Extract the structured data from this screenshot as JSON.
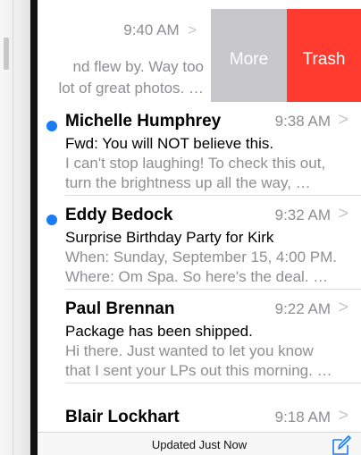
{
  "swiped_message": {
    "time": "9:40 AM",
    "chevron": ">",
    "preview_line_1": "nd flew by. Way too",
    "preview_line_2": "lot of great photos. …",
    "more_label": "More",
    "trash_label": "Trash"
  },
  "messages": [
    {
      "sender": "Michelle Humphrey",
      "time": "9:38 AM",
      "unread": true,
      "subject": "Fwd: You will NOT believe this.",
      "preview_line_1": "I can't stop laughing! To check this out,",
      "preview_line_2": "turn the brightness up all the way, …"
    },
    {
      "sender": "Eddy Bedock",
      "time": "9:32 AM",
      "unread": true,
      "subject": "Surprise Birthday Party for Kirk",
      "preview_line_1": "When: Sunday, September 15, 4:00 PM.",
      "preview_line_2": "Where: Om Spa. So here's the deal. …"
    },
    {
      "sender": "Paul Brennan",
      "time": "9:22 AM",
      "unread": false,
      "subject": "Package has been shipped.",
      "preview_line_1": "Hi there. Just wanted to let you know",
      "preview_line_2": "that I sent your LPs out this morning. …"
    },
    {
      "sender": "Blair Lockhart",
      "time": "9:18 AM",
      "unread": false
    }
  ],
  "chevron_symbol": ">",
  "toolbar": {
    "status": "Updated Just Now",
    "compose_icon": "compose-icon"
  },
  "colors": {
    "accent": "#1a7cf5",
    "trash": "#ff3b30",
    "more": "#c7c7cc"
  }
}
